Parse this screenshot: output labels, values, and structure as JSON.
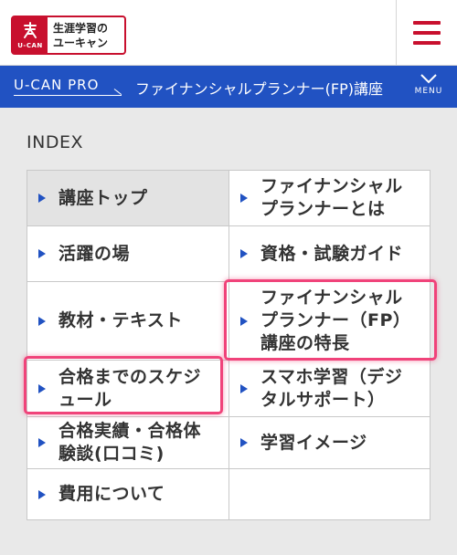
{
  "header": {
    "logo_mark_text": "U-CAN",
    "logo_text_line1": "生涯学習の",
    "logo_text_line2": "ユーキャン",
    "menu_icon": "hamburger-icon"
  },
  "nav_bar": {
    "brand": "U-CAN PRO",
    "course_title": "ファイナンシャルプランナー(FP)講座",
    "menu_label": "MENU",
    "menu_icon": "chevron-down-icon"
  },
  "index": {
    "title": "INDEX",
    "items": [
      {
        "line1": "講座トップ",
        "line2": ""
      },
      {
        "line1": "ファイナンシャル",
        "line2": "プランナーとは"
      },
      {
        "line1": "活躍の場",
        "line2": ""
      },
      {
        "line1": "資格・試験ガイド",
        "line2": ""
      },
      {
        "line1": "教材・テキスト",
        "line2": ""
      },
      {
        "line1": "ファイナンシャル",
        "line2": "プランナー（FP）",
        "line3": "講座の特長"
      },
      {
        "line1": "合格までのスケジ",
        "line2": "ュール"
      },
      {
        "line1": "スマホ学習（デジ",
        "line2": "タルサポート）"
      },
      {
        "line1": "合格実績・合格体",
        "line2": "験談(口コミ)"
      },
      {
        "line1": "学習イメージ",
        "line2": ""
      },
      {
        "line1": "費用について",
        "line2": ""
      }
    ]
  },
  "colors": {
    "brand_red": "#c8102e",
    "nav_blue": "#2152c2",
    "highlight_pink": "#f0437a"
  }
}
